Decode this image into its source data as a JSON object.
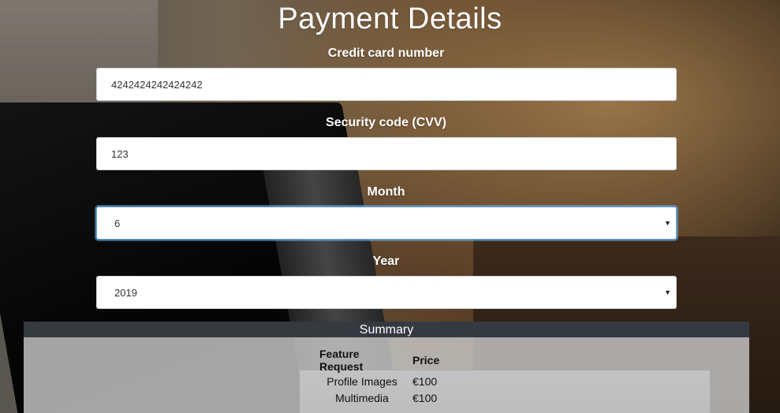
{
  "page": {
    "title": "Payment Details"
  },
  "form": {
    "card_number": {
      "label": "Credit card number",
      "value": "4242424242424242"
    },
    "cvv": {
      "label": "Security code (CVV)",
      "value": "123"
    },
    "month": {
      "label": "Month",
      "value": "6"
    },
    "year": {
      "label": "Year",
      "value": "2019"
    }
  },
  "summary": {
    "title": "Summary",
    "headers": {
      "feature": "Feature Request",
      "price": "Price"
    },
    "rows": [
      {
        "feature": "Profile Images",
        "price": "€100"
      },
      {
        "feature": "Multimedia",
        "price": "€100"
      }
    ]
  }
}
